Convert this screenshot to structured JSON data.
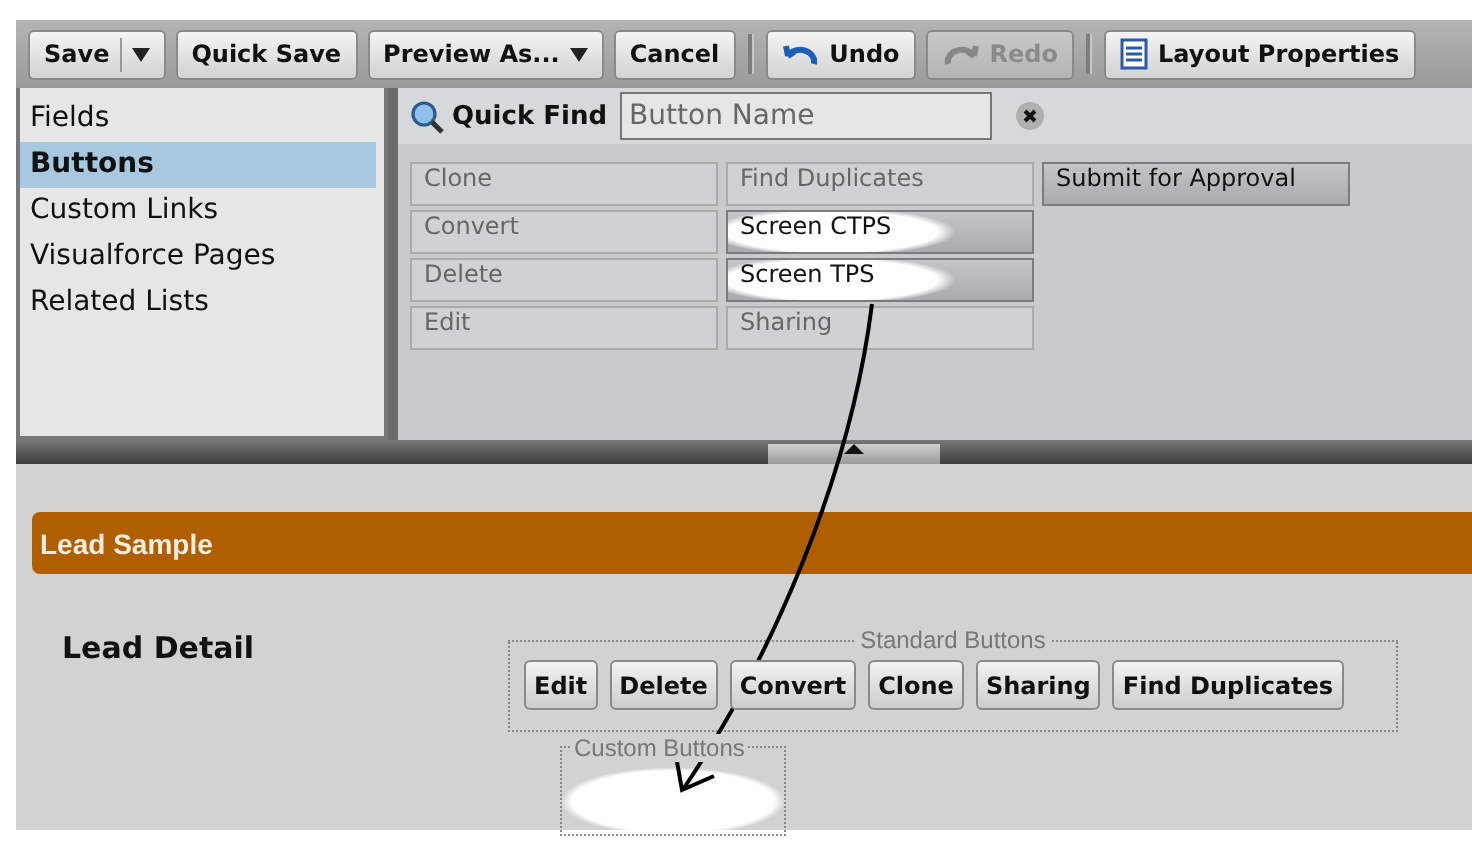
{
  "toolbar": {
    "groups": [
      {
        "buttons": [
          {
            "label": "Save",
            "kind": "split",
            "disabled": false
          },
          {
            "label": "Quick Save",
            "kind": "plain",
            "disabled": false
          },
          {
            "label": "Preview As...",
            "kind": "dropdown",
            "disabled": false
          },
          {
            "label": "Cancel",
            "kind": "plain",
            "disabled": false
          }
        ]
      },
      {
        "buttons": [
          {
            "label": "Undo",
            "kind": "undo",
            "disabled": false
          },
          {
            "label": "Redo",
            "kind": "redo",
            "disabled": true
          }
        ]
      },
      {
        "buttons": [
          {
            "label": "Layout Properties",
            "kind": "properties",
            "disabled": false
          }
        ]
      }
    ]
  },
  "sidebar": {
    "items": [
      {
        "label": "Fields",
        "selected": false
      },
      {
        "label": "Buttons",
        "selected": true
      },
      {
        "label": "Custom Links",
        "selected": false
      },
      {
        "label": "Visualforce Pages",
        "selected": false
      },
      {
        "label": "Related Lists",
        "selected": false
      }
    ]
  },
  "quick_find": {
    "label": "Quick Find",
    "placeholder": "Button Name"
  },
  "palette": {
    "columns": [
      [
        {
          "label": "Clone",
          "used": true,
          "annotated": false
        },
        {
          "label": "Convert",
          "used": true,
          "annotated": false
        },
        {
          "label": "Delete",
          "used": true,
          "annotated": false
        },
        {
          "label": "Edit",
          "used": true,
          "annotated": false
        }
      ],
      [
        {
          "label": "Find Duplicates",
          "used": true,
          "annotated": false
        },
        {
          "label": "Screen CTPS",
          "used": false,
          "annotated": true
        },
        {
          "label": "Screen TPS",
          "used": false,
          "annotated": true
        },
        {
          "label": "Sharing",
          "used": true,
          "annotated": false
        }
      ],
      [
        {
          "label": "Submit for Approval",
          "used": false,
          "annotated": false
        }
      ]
    ]
  },
  "layout": {
    "section_title": "Lead Sample",
    "detail_label": "Lead Detail",
    "standard_buttons": {
      "legend": "Standard Buttons",
      "buttons": [
        "Edit",
        "Delete",
        "Convert",
        "Clone",
        "Sharing",
        "Find Duplicates"
      ]
    },
    "custom_buttons": {
      "legend": "Custom Buttons",
      "annotated": true
    }
  }
}
